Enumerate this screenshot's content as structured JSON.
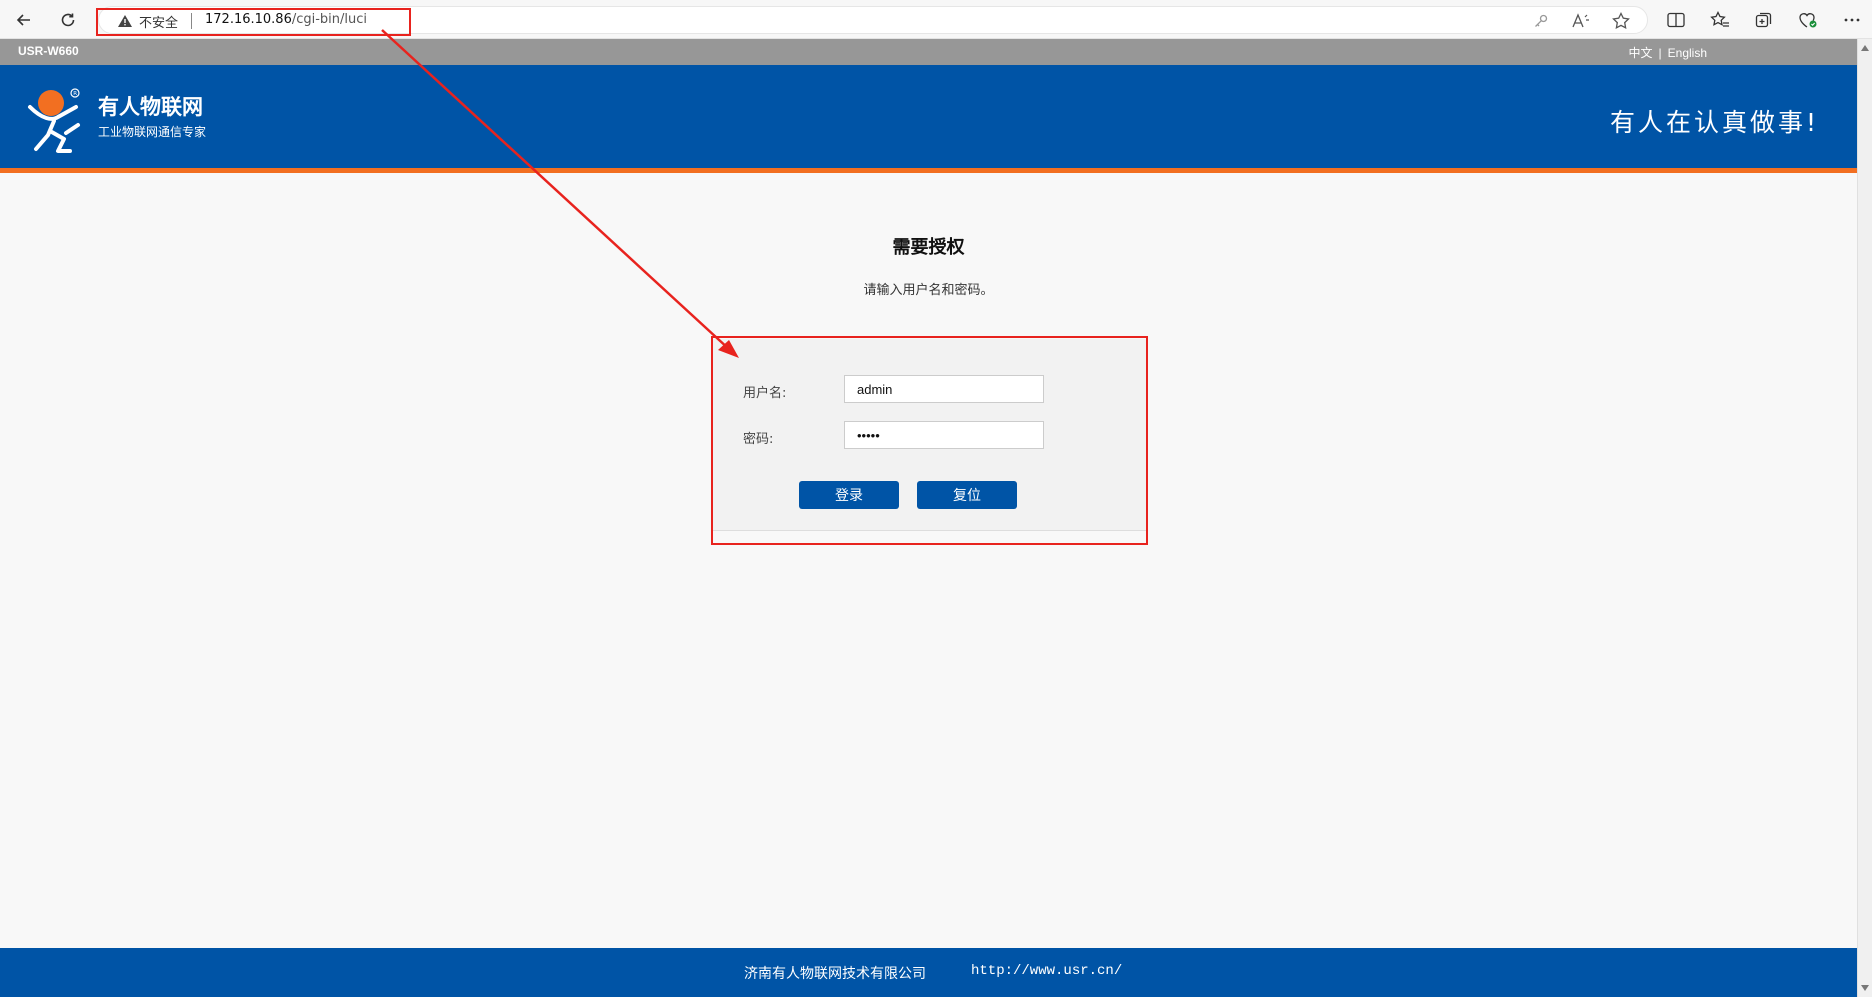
{
  "browser": {
    "not_secure_label": "不安全",
    "url_host": "172.16.10.86",
    "url_path": "/cgi-bin/luci"
  },
  "page": {
    "model": "USR-W660",
    "lang_zh": "中文",
    "lang_divider": "|",
    "lang_en": "English",
    "brand_name": "有人物联网",
    "brand_sub": "工业物联网通信专家",
    "slogan": "有人在认真做事!",
    "login_title": "需要授权",
    "login_desc": "请输入用户名和密码。",
    "username_label": "用户名:",
    "username_value": "admin",
    "password_label": "密码:",
    "password_value": "admin",
    "login_button": "登录",
    "reset_button": "复位",
    "footer_company": "济南有人物联网技术有限公司",
    "footer_url": "http://www.usr.cn/"
  },
  "colors": {
    "brand_blue": "#0054a6",
    "accent_orange": "#f26f21",
    "annotation_red": "#e8231e"
  }
}
